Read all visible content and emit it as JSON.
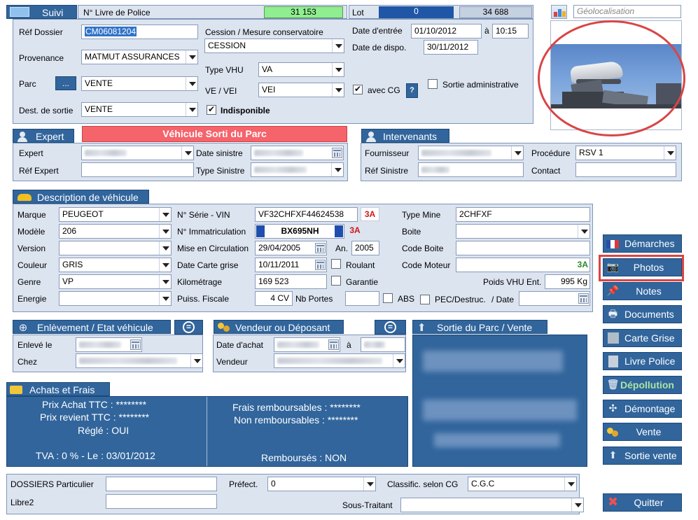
{
  "colors": {
    "accent": "#31659c",
    "panel": "#dce4f0",
    "alert": "#f5636b",
    "green_counter": "#90ee90",
    "lot_blue": "#1f56a6"
  },
  "suivi": {
    "title": "Suivi",
    "livre_label": "N° Livre de Police",
    "livre_value": "31 153",
    "lot_label": "Lot",
    "lot_value": "0",
    "lot_total": "34 688",
    "ref_dossier_label": "Réf Dossier",
    "ref_dossier_value": "CM06081204",
    "provenance_label": "Provenance",
    "provenance_value": "MATMUT ASSURANCES",
    "parc_label": "Parc",
    "parc_btn": "...",
    "parc_value": "VENTE",
    "dest_label": "Dest. de sortie",
    "dest_value": "VENTE",
    "cession_label": "Cession / Mesure conservatoire",
    "cession_value": "CESSION",
    "type_vhu_label": "Type VHU",
    "type_vhu_value": "VA",
    "ve_vei_label": "VE / VEI",
    "ve_vei_value": "VEI",
    "indisponible_label": "Indisponible",
    "date_entree_label": "Date d'entrée",
    "date_entree_value": "01/10/2012",
    "a_label": "à",
    "heure_value": "10:15",
    "date_dispo_label": "Date de dispo.",
    "date_dispo_value": "30/11/2012",
    "avec_cg_label": "avec CG",
    "help_btn": "?",
    "sortie_admin_label": "Sortie administrative"
  },
  "geoloc": {
    "placeholder": "Géolocalisation"
  },
  "expert": {
    "title": "Expert",
    "banner": "Véhicule Sorti du Parc",
    "expert_label": "Expert",
    "ref_expert_label": "Réf Expert",
    "date_sinistre_label": "Date sinistre",
    "type_sinistre_label": "Type Sinistre"
  },
  "intervenants": {
    "title": "Intervenants",
    "fournisseur_label": "Fournisseur",
    "ref_sinistre_label": "Réf Sinistre",
    "procedure_label": "Procédure",
    "procedure_value": "RSV 1",
    "contact_label": "Contact"
  },
  "vehicule": {
    "title": "Description de véhicule",
    "marque_label": "Marque",
    "marque_value": "PEUGEOT",
    "modele_label": "Modèle",
    "modele_value": "206",
    "version_label": "Version",
    "version_value": "",
    "couleur_label": "Couleur",
    "couleur_value": "GRIS",
    "genre_label": "Genre",
    "genre_value": "VP",
    "energie_label": "Energie",
    "energie_value": "",
    "vin_label": "N° Série - VIN",
    "vin_value": "VF32CHFXF44624538",
    "badge": "3A",
    "immat_label": "N° Immatriculation",
    "immat_value": "BX695NH",
    "mise_circ_label": "Mise en Circulation",
    "mise_circ_value": "29/04/2005",
    "an_label": "An.",
    "an_value": "2005",
    "date_cg_label": "Date Carte grise",
    "date_cg_value": "10/11/2011",
    "roulant_label": "Roulant",
    "km_label": "Kilométrage",
    "km_value": "169 523",
    "garantie_label": "Garantie",
    "puiss_label": "Puiss. Fiscale",
    "puiss_value": "4 CV",
    "portes_label": "Nb Portes",
    "abs_label": "ABS",
    "type_mine_label": "Type Mine",
    "type_mine_value": "2CHFXF",
    "boite_label": "Boite",
    "code_boite_label": "Code Boite",
    "code_moteur_label": "Code Moteur",
    "code_moteur_badge": "3A",
    "poids_label": "Poids VHU Ent.",
    "poids_value": "995 Kg",
    "pec_label": "PEC/Destruc.",
    "date_label": "/ Date"
  },
  "enlevement": {
    "title": "Enlèvement / Etat véhicule",
    "enleve_label": "Enlevé le",
    "chez_label": "Chez"
  },
  "vendeur": {
    "title": "Vendeur ou Déposant",
    "date_achat_label": "Date d'achat",
    "a_label": "à",
    "vendeur_label": "Vendeur"
  },
  "sortie": {
    "title": "Sortie du Parc / Vente"
  },
  "achats": {
    "title": "Achats et Frais",
    "prix_achat": "Prix Achat TTC :  ********",
    "prix_revient": "Prix revient TTC :  ********",
    "regle": "Réglé :  OUI",
    "tva": "TVA : 0 %  - Le :  03/01/2012",
    "frais_remb": "Frais remboursables :  ********",
    "non_remb": "Non remboursables :  ********",
    "rembourses": "Remboursés :  NON"
  },
  "bottom": {
    "dossiers_label": "DOSSIERS Particulier",
    "libre2_label": "Libre2",
    "prefect_label": "Préfect.",
    "prefect_value": "0",
    "classif_label": "Classific. selon CG",
    "classif_value": "C.G.C",
    "sous_traitant_label": "Sous-Traitant"
  },
  "actions": {
    "demarches": "Démarches",
    "photos": "Photos",
    "notes": "Notes",
    "documents": "Documents",
    "carte_grise": "Carte Grise",
    "livre_police": "Livre Police",
    "depollution": "Dépollution",
    "demontage": "Démontage",
    "vente": "Vente",
    "sortie_vente": "Sortie vente",
    "quitter": "Quitter"
  }
}
